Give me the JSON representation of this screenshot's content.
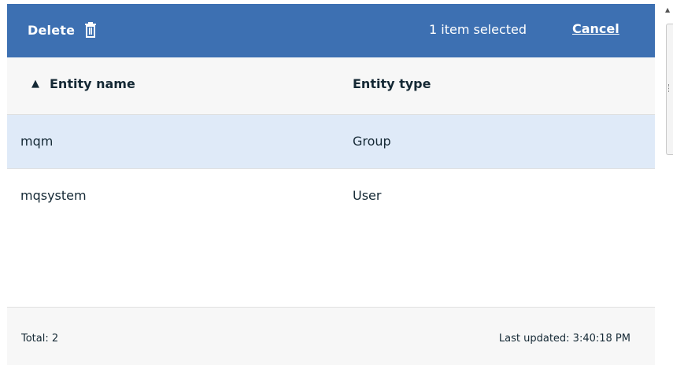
{
  "action_bar": {
    "delete_label": "Delete",
    "selection_text": "1 item selected",
    "cancel_label": "Cancel",
    "background_color": "#3d70b2"
  },
  "table": {
    "columns": [
      {
        "label": "Entity name",
        "sorted": "ascending",
        "sort_icon": "▲"
      },
      {
        "label": "Entity type"
      }
    ],
    "rows": [
      {
        "entity_name": "mqm",
        "entity_type": "Group",
        "selected": true
      },
      {
        "entity_name": "mqsystem",
        "entity_type": "User",
        "selected": false
      }
    ],
    "selected_row_color": "#dfeaf8"
  },
  "footer": {
    "total": "Total: 2",
    "last_updated": "Last updated: 3:40:18 PM"
  },
  "icons": {
    "delete": "trash-icon",
    "sort": "sort-ascending-icon",
    "scroll_up": "scroll-up-arrow-icon"
  }
}
